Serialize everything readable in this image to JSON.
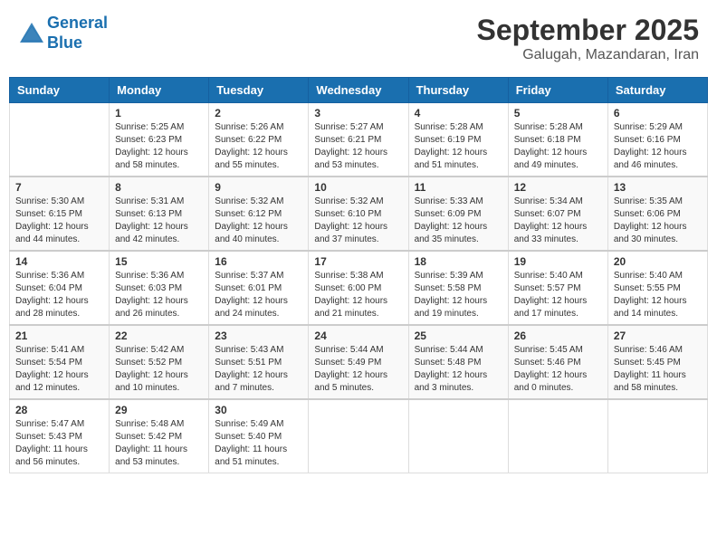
{
  "header": {
    "logo_line1": "General",
    "logo_line2": "Blue",
    "main_title": "September 2025",
    "sub_title": "Galugah, Mazandaran, Iran"
  },
  "calendar": {
    "days_of_week": [
      "Sunday",
      "Monday",
      "Tuesday",
      "Wednesday",
      "Thursday",
      "Friday",
      "Saturday"
    ],
    "weeks": [
      [
        {
          "day": "",
          "content": ""
        },
        {
          "day": "1",
          "content": "Sunrise: 5:25 AM\nSunset: 6:23 PM\nDaylight: 12 hours\nand 58 minutes."
        },
        {
          "day": "2",
          "content": "Sunrise: 5:26 AM\nSunset: 6:22 PM\nDaylight: 12 hours\nand 55 minutes."
        },
        {
          "day": "3",
          "content": "Sunrise: 5:27 AM\nSunset: 6:21 PM\nDaylight: 12 hours\nand 53 minutes."
        },
        {
          "day": "4",
          "content": "Sunrise: 5:28 AM\nSunset: 6:19 PM\nDaylight: 12 hours\nand 51 minutes."
        },
        {
          "day": "5",
          "content": "Sunrise: 5:28 AM\nSunset: 6:18 PM\nDaylight: 12 hours\nand 49 minutes."
        },
        {
          "day": "6",
          "content": "Sunrise: 5:29 AM\nSunset: 6:16 PM\nDaylight: 12 hours\nand 46 minutes."
        }
      ],
      [
        {
          "day": "7",
          "content": "Sunrise: 5:30 AM\nSunset: 6:15 PM\nDaylight: 12 hours\nand 44 minutes."
        },
        {
          "day": "8",
          "content": "Sunrise: 5:31 AM\nSunset: 6:13 PM\nDaylight: 12 hours\nand 42 minutes."
        },
        {
          "day": "9",
          "content": "Sunrise: 5:32 AM\nSunset: 6:12 PM\nDaylight: 12 hours\nand 40 minutes."
        },
        {
          "day": "10",
          "content": "Sunrise: 5:32 AM\nSunset: 6:10 PM\nDaylight: 12 hours\nand 37 minutes."
        },
        {
          "day": "11",
          "content": "Sunrise: 5:33 AM\nSunset: 6:09 PM\nDaylight: 12 hours\nand 35 minutes."
        },
        {
          "day": "12",
          "content": "Sunrise: 5:34 AM\nSunset: 6:07 PM\nDaylight: 12 hours\nand 33 minutes."
        },
        {
          "day": "13",
          "content": "Sunrise: 5:35 AM\nSunset: 6:06 PM\nDaylight: 12 hours\nand 30 minutes."
        }
      ],
      [
        {
          "day": "14",
          "content": "Sunrise: 5:36 AM\nSunset: 6:04 PM\nDaylight: 12 hours\nand 28 minutes."
        },
        {
          "day": "15",
          "content": "Sunrise: 5:36 AM\nSunset: 6:03 PM\nDaylight: 12 hours\nand 26 minutes."
        },
        {
          "day": "16",
          "content": "Sunrise: 5:37 AM\nSunset: 6:01 PM\nDaylight: 12 hours\nand 24 minutes."
        },
        {
          "day": "17",
          "content": "Sunrise: 5:38 AM\nSunset: 6:00 PM\nDaylight: 12 hours\nand 21 minutes."
        },
        {
          "day": "18",
          "content": "Sunrise: 5:39 AM\nSunset: 5:58 PM\nDaylight: 12 hours\nand 19 minutes."
        },
        {
          "day": "19",
          "content": "Sunrise: 5:40 AM\nSunset: 5:57 PM\nDaylight: 12 hours\nand 17 minutes."
        },
        {
          "day": "20",
          "content": "Sunrise: 5:40 AM\nSunset: 5:55 PM\nDaylight: 12 hours\nand 14 minutes."
        }
      ],
      [
        {
          "day": "21",
          "content": "Sunrise: 5:41 AM\nSunset: 5:54 PM\nDaylight: 12 hours\nand 12 minutes."
        },
        {
          "day": "22",
          "content": "Sunrise: 5:42 AM\nSunset: 5:52 PM\nDaylight: 12 hours\nand 10 minutes."
        },
        {
          "day": "23",
          "content": "Sunrise: 5:43 AM\nSunset: 5:51 PM\nDaylight: 12 hours\nand 7 minutes."
        },
        {
          "day": "24",
          "content": "Sunrise: 5:44 AM\nSunset: 5:49 PM\nDaylight: 12 hours\nand 5 minutes."
        },
        {
          "day": "25",
          "content": "Sunrise: 5:44 AM\nSunset: 5:48 PM\nDaylight: 12 hours\nand 3 minutes."
        },
        {
          "day": "26",
          "content": "Sunrise: 5:45 AM\nSunset: 5:46 PM\nDaylight: 12 hours\nand 0 minutes."
        },
        {
          "day": "27",
          "content": "Sunrise: 5:46 AM\nSunset: 5:45 PM\nDaylight: 11 hours\nand 58 minutes."
        }
      ],
      [
        {
          "day": "28",
          "content": "Sunrise: 5:47 AM\nSunset: 5:43 PM\nDaylight: 11 hours\nand 56 minutes."
        },
        {
          "day": "29",
          "content": "Sunrise: 5:48 AM\nSunset: 5:42 PM\nDaylight: 11 hours\nand 53 minutes."
        },
        {
          "day": "30",
          "content": "Sunrise: 5:49 AM\nSunset: 5:40 PM\nDaylight: 11 hours\nand 51 minutes."
        },
        {
          "day": "",
          "content": ""
        },
        {
          "day": "",
          "content": ""
        },
        {
          "day": "",
          "content": ""
        },
        {
          "day": "",
          "content": ""
        }
      ]
    ]
  }
}
